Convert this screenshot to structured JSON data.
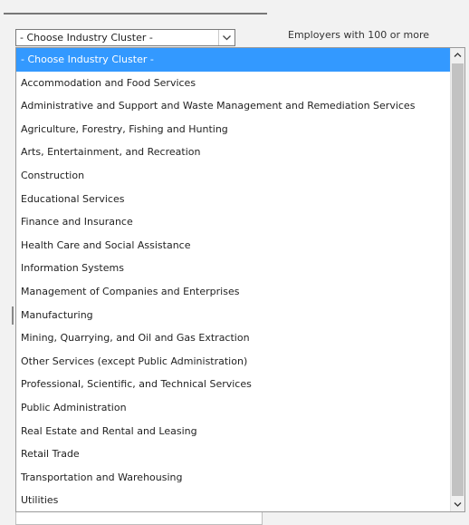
{
  "dropdown": {
    "selected_value": "- Choose Industry Cluster -",
    "arrow_icon": "chevron-down-icon"
  },
  "filter": {
    "label": "Employers with 100 or more"
  },
  "options": [
    "- Choose Industry Cluster -",
    "Accommodation and Food Services",
    "Administrative and Support and Waste Management and Remediation Services",
    "Agriculture, Forestry, Fishing and Hunting",
    "Arts, Entertainment, and Recreation",
    "Construction",
    "Educational Services",
    "Finance and Insurance",
    "Health Care and Social Assistance",
    "Information Systems",
    "Management of Companies and Enterprises",
    "Manufacturing",
    "Mining, Quarrying, and Oil and Gas Extraction",
    "Other Services (except Public Administration)",
    "Professional, Scientific, and Technical Services",
    "Public Administration",
    "Real Estate and Rental and Leasing",
    "Retail Trade",
    "Transportation and Warehousing",
    "Utilities"
  ],
  "highlighted_index": 0,
  "colors": {
    "highlight": "#3399ff",
    "highlight_text": "#ffffff",
    "scroll_thumb": "#c2c2c2"
  }
}
